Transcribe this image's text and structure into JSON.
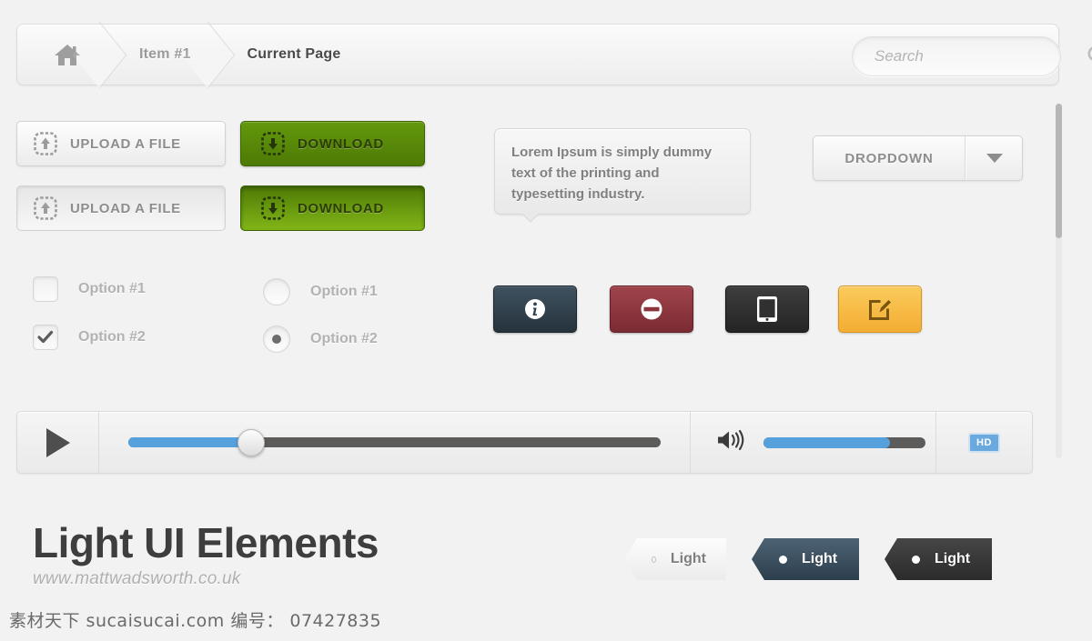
{
  "breadcrumb": {
    "home_icon": "home-icon",
    "items": [
      {
        "label": "Item #1",
        "current": false
      },
      {
        "label": "Current Page",
        "current": true
      }
    ]
  },
  "search": {
    "placeholder": "Search",
    "value": "",
    "icon": "search-icon"
  },
  "buttons": {
    "upload_1": {
      "label": "UPLOAD A FILE",
      "icon": "upload-file-icon"
    },
    "upload_2": {
      "label": "UPLOAD A FILE",
      "icon": "upload-file-icon"
    },
    "download_1": {
      "label": "DOWNLOAD",
      "icon": "download-file-icon"
    },
    "download_2": {
      "label": "DOWNLOAD",
      "icon": "download-file-icon"
    }
  },
  "tooltip": {
    "text": "Lorem Ipsum is simply dummy text of the printing and typesetting industry."
  },
  "dropdown": {
    "label": "DROPDOWN",
    "arrow_icon": "chevron-down-icon"
  },
  "checkboxes": [
    {
      "label": "Option #1",
      "checked": false
    },
    {
      "label": "Option #2",
      "checked": true
    }
  ],
  "radios": [
    {
      "label": "Option #1",
      "selected": false
    },
    {
      "label": "Option #2",
      "selected": true
    }
  ],
  "icon_buttons": [
    {
      "name": "info-button",
      "icon": "info-icon",
      "color": "#2f414e"
    },
    {
      "name": "deny-button",
      "icon": "no-entry-icon",
      "color": "#8b353d"
    },
    {
      "name": "tablet-button",
      "icon": "tablet-icon",
      "color": "#303030"
    },
    {
      "name": "edit-button",
      "icon": "edit-compose-icon",
      "color": "#f6bb45"
    }
  ],
  "player": {
    "play_icon": "play-icon",
    "seek_percent": 23,
    "volume_icon": "volume-high-icon",
    "volume_percent": 78,
    "hd_label": "HD"
  },
  "footer": {
    "title": "Light UI Elements",
    "subtitle": "www.mattwadsworth.co.uk"
  },
  "tags": [
    {
      "label": "Light",
      "style": "light"
    },
    {
      "label": "Light",
      "style": "blue"
    },
    {
      "label": "Light",
      "style": "dark"
    }
  ],
  "scrollbar": {
    "thumb_position": 0
  },
  "watermark": {
    "text": "素材天下 sucaisucai.com  编号： 07427835"
  },
  "colors": {
    "accent_blue": "#56a0dc",
    "download_green": "#4d7a06",
    "page_bg": "#f2f2f2"
  }
}
